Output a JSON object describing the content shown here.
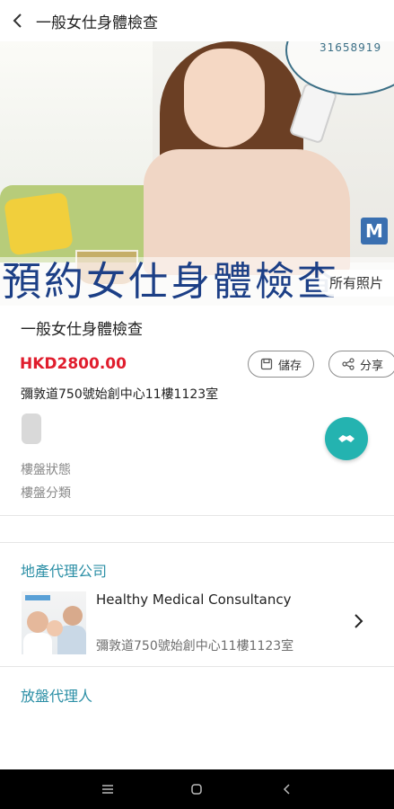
{
  "header": {
    "title": "一般女仕身體檢查"
  },
  "hero": {
    "bubble_text": "31658919",
    "logo_text": "M",
    "banner_text": "預約女仕身體檢查",
    "all_photos_label": "所有照片"
  },
  "listing": {
    "title": "一般女仕身體檢查",
    "price": "HKD2800.00",
    "save_label": "儲存",
    "share_label": "分享",
    "address": "彌敦道750號始創中心11樓1123室",
    "status_label": "樓盤狀態",
    "category_label": "樓盤分類"
  },
  "agency_section": {
    "title": "地產代理公司",
    "name": "Healthy Medical Consultancy",
    "address": "彌敦道750號始創中心11樓1123室"
  },
  "agent_section": {
    "title": "放盤代理人"
  },
  "colors": {
    "price": "#e01d2d",
    "accent": "#2c8fa6",
    "fab": "#24b3b0"
  }
}
